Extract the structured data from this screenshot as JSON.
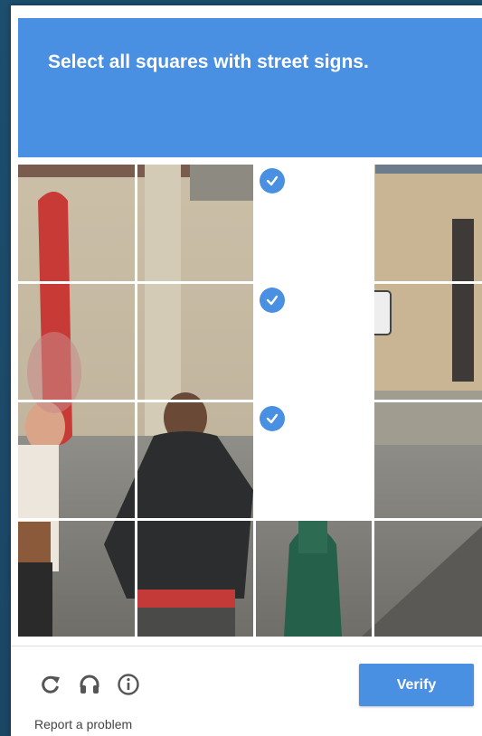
{
  "challenge": {
    "prompt": "Select all squares with street signs.",
    "tiles": [
      {
        "row": 1,
        "col": 1,
        "selected": false
      },
      {
        "row": 1,
        "col": 2,
        "selected": false
      },
      {
        "row": 1,
        "col": 3,
        "selected": true
      },
      {
        "row": 1,
        "col": 4,
        "selected": false
      },
      {
        "row": 2,
        "col": 1,
        "selected": false
      },
      {
        "row": 2,
        "col": 2,
        "selected": false
      },
      {
        "row": 2,
        "col": 3,
        "selected": true
      },
      {
        "row": 2,
        "col": 4,
        "selected": false
      },
      {
        "row": 3,
        "col": 1,
        "selected": false
      },
      {
        "row": 3,
        "col": 2,
        "selected": false
      },
      {
        "row": 3,
        "col": 3,
        "selected": true
      },
      {
        "row": 3,
        "col": 4,
        "selected": false
      },
      {
        "row": 4,
        "col": 1,
        "selected": false
      },
      {
        "row": 4,
        "col": 2,
        "selected": false
      },
      {
        "row": 4,
        "col": 3,
        "selected": false
      },
      {
        "row": 4,
        "col": 4,
        "selected": false
      }
    ]
  },
  "footer": {
    "icons": [
      "reload-icon",
      "headphones-icon",
      "info-icon"
    ],
    "verify_label": "Verify",
    "report_label": "Report a problem"
  },
  "colors": {
    "accent": "#4a90e2",
    "background": "#1d4e6e"
  }
}
